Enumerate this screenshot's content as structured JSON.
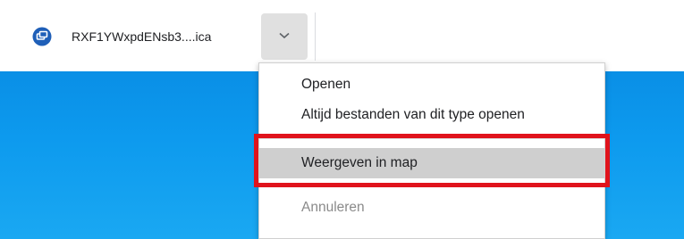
{
  "download_shelf": {
    "file_name": "RXF1YWxpdENsb3....ica",
    "file_icon": "citrix-file-icon",
    "more_icon": "chevron-down-icon"
  },
  "context_menu": {
    "items": [
      {
        "label": "Openen",
        "enabled": true
      },
      {
        "label": "Altijd bestanden van dit type openen",
        "enabled": true
      },
      {
        "label": "Weergeven in map",
        "enabled": true,
        "hovered": true
      },
      {
        "label": "Annuleren",
        "enabled": true
      }
    ]
  },
  "colors": {
    "highlight_annotation": "#e0131c",
    "desktop_blue": "#0d9aee",
    "hover_gray": "#cfcfcf",
    "icon_blue": "#1f5fb8"
  }
}
